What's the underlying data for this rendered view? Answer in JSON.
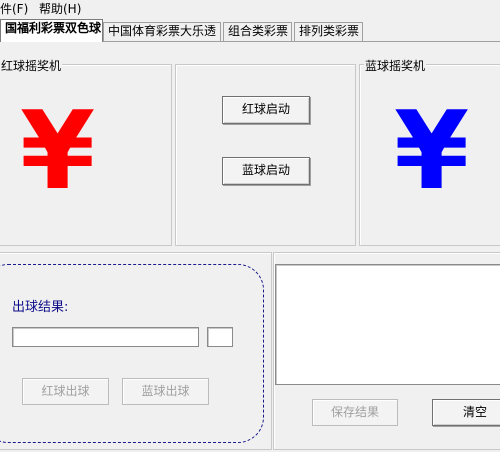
{
  "menu": [
    "件(F)",
    "帮助(H)"
  ],
  "tabs": [
    "国福利彩票双色球",
    "中国体育彩票大乐透",
    "组合类彩票",
    "排列类彩票"
  ],
  "left_group": {
    "title": "红球摇奖机",
    "symbol": "¥",
    "color": "#ff0000"
  },
  "right_group": {
    "title": "蓝球摇奖机",
    "symbol": "¥",
    "color": "#0000ff"
  },
  "center_buttons": {
    "red_start": "红球启动",
    "blue_start": "蓝球启动"
  },
  "result": {
    "label": "出球结果:",
    "red_value": "",
    "blue_value": "",
    "red_out": "红球出球",
    "blue_out": "蓝球出球"
  },
  "log": {
    "text": "",
    "save": "保存结果",
    "clear": "清空"
  }
}
